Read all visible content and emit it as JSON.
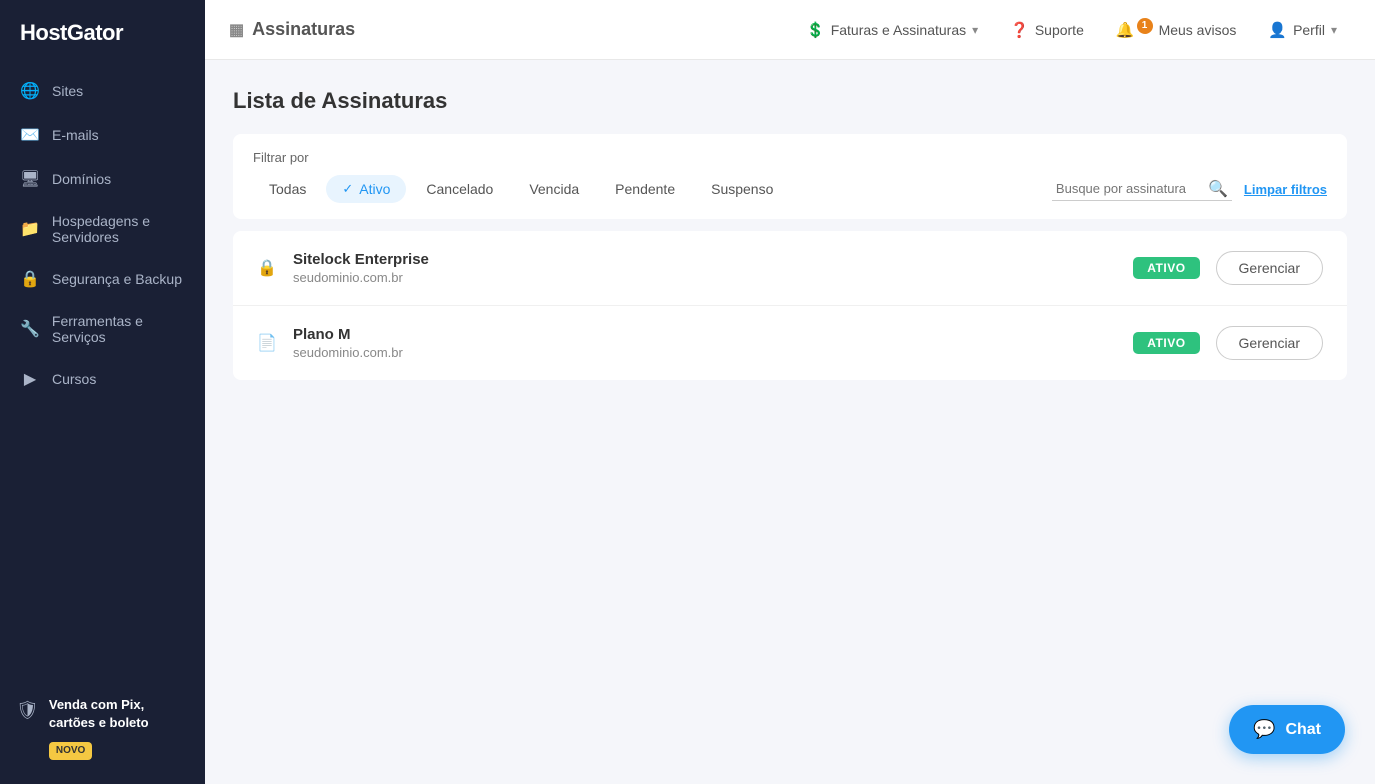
{
  "app": {
    "logo": "HostGator"
  },
  "sidebar": {
    "items": [
      {
        "id": "sites",
        "label": "Sites",
        "icon": "🌐"
      },
      {
        "id": "emails",
        "label": "E-mails",
        "icon": "✉️"
      },
      {
        "id": "domains",
        "label": "Domínios",
        "icon": "🖥"
      },
      {
        "id": "hosting",
        "label": "Hospedagens e Servidores",
        "icon": "📁"
      },
      {
        "id": "security",
        "label": "Segurança e Backup",
        "icon": "🔒"
      },
      {
        "id": "tools",
        "label": "Ferramentas e Serviços",
        "icon": "🔧"
      },
      {
        "id": "courses",
        "label": "Cursos",
        "icon": "▶"
      }
    ],
    "promo": {
      "title": "Venda com Pix, cartões e boleto",
      "badge": "NOVO",
      "icon": "🛡"
    }
  },
  "topbar": {
    "page_icon": "▦",
    "page_title": "Assinaturas",
    "nav": [
      {
        "id": "billing",
        "label": "Faturas e Assinaturas",
        "icon": "💲",
        "has_arrow": true
      },
      {
        "id": "support",
        "label": "Suporte",
        "icon": "❓"
      },
      {
        "id": "notifications",
        "label": "Meus avisos",
        "icon": "🔔",
        "badge": "1"
      },
      {
        "id": "profile",
        "label": "Perfil",
        "icon": "👤",
        "has_arrow": true
      }
    ]
  },
  "main": {
    "title": "Lista de Assinaturas",
    "filter": {
      "label": "Filtrar por",
      "tabs": [
        {
          "id": "all",
          "label": "Todas",
          "active": false
        },
        {
          "id": "active",
          "label": "Ativo",
          "active": true
        },
        {
          "id": "canceled",
          "label": "Cancelado",
          "active": false
        },
        {
          "id": "expired",
          "label": "Vencida",
          "active": false
        },
        {
          "id": "pending",
          "label": "Pendente",
          "active": false
        },
        {
          "id": "suspended",
          "label": "Suspenso",
          "active": false
        }
      ],
      "search_placeholder": "Busque por assinatura",
      "clear_label": "Limpar filtros"
    },
    "subscriptions": [
      {
        "id": "sitelock",
        "name": "Sitelock Enterprise",
        "domain": "seudominio.com.br",
        "status": "ATIVO",
        "icon": "lock",
        "manage_label": "Gerenciar"
      },
      {
        "id": "plano-m",
        "name": "Plano M",
        "domain": "seudominio.com.br",
        "status": "ATIVO",
        "icon": "folder",
        "manage_label": "Gerenciar"
      }
    ]
  },
  "chat": {
    "label": "Chat"
  }
}
